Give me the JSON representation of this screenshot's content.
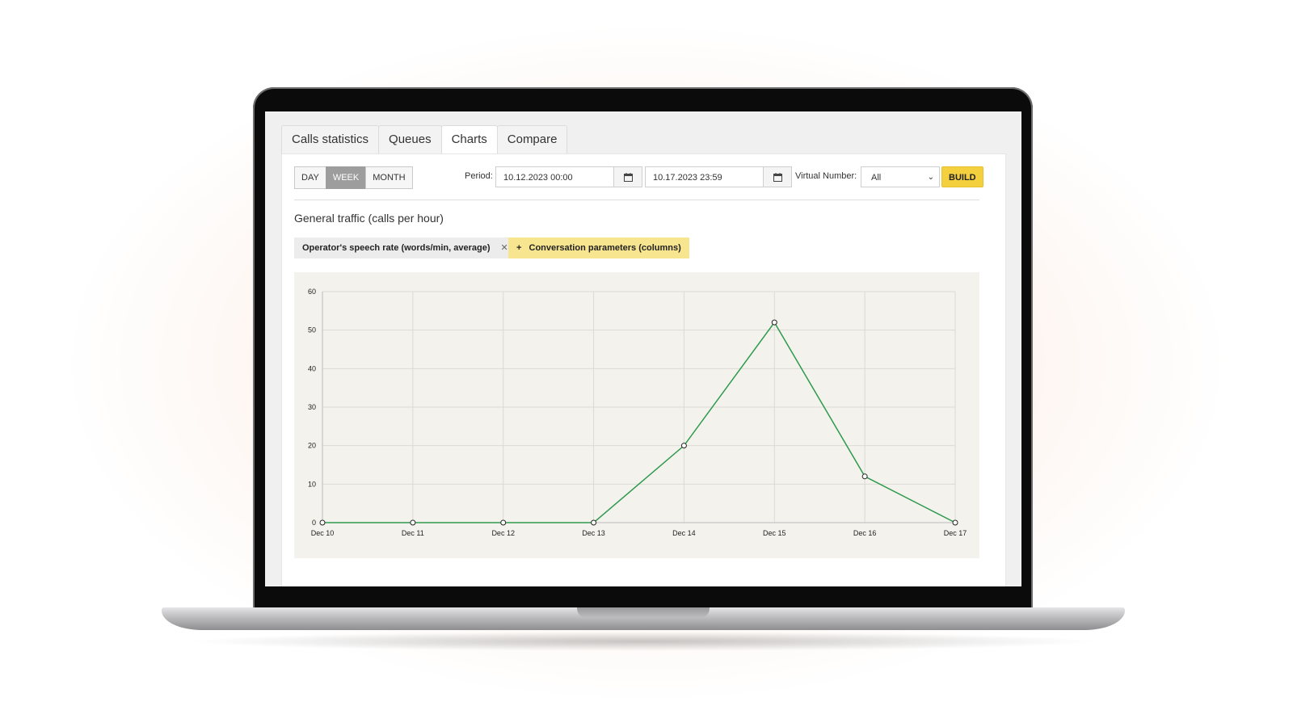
{
  "tabs": [
    {
      "label": "Calls statistics",
      "active": false
    },
    {
      "label": "Queues",
      "active": false
    },
    {
      "label": "Charts",
      "active": true
    },
    {
      "label": "Compare",
      "active": false
    }
  ],
  "range_buttons": [
    {
      "label": "DAY",
      "active": false
    },
    {
      "label": "WEEK",
      "active": true
    },
    {
      "label": "MONTH",
      "active": false
    }
  ],
  "period": {
    "label": "Period:",
    "start": "10.12.2023 00:00",
    "end": "10.17.2023 23:59"
  },
  "virtual_number": {
    "label": "Virtual Number:",
    "value": "All"
  },
  "build_label": "BUILD",
  "section_title": "General traffic (calls per hour)",
  "chips": {
    "metric": "Operator's speech rate (words/min, average)",
    "remove_symbol": "✕",
    "add_label": "Conversation parameters (columns)",
    "add_symbol": "+"
  },
  "colors": {
    "line": "#2e9a4e",
    "build": "#f4d03f",
    "add_chip": "#f8e590"
  },
  "chart_data": {
    "type": "line",
    "categories": [
      "Dec 10",
      "Dec 11",
      "Dec 12",
      "Dec 13",
      "Dec 14",
      "Dec 15",
      "Dec 16",
      "Dec 17"
    ],
    "series": [
      {
        "values": [
          0,
          0,
          0,
          0,
          20,
          52,
          12,
          0
        ]
      }
    ],
    "ylim": [
      0,
      60
    ],
    "yticks": [
      0,
      10,
      20,
      30,
      40,
      50,
      60
    ],
    "grid": true,
    "title": "",
    "xlabel": "",
    "ylabel": ""
  }
}
